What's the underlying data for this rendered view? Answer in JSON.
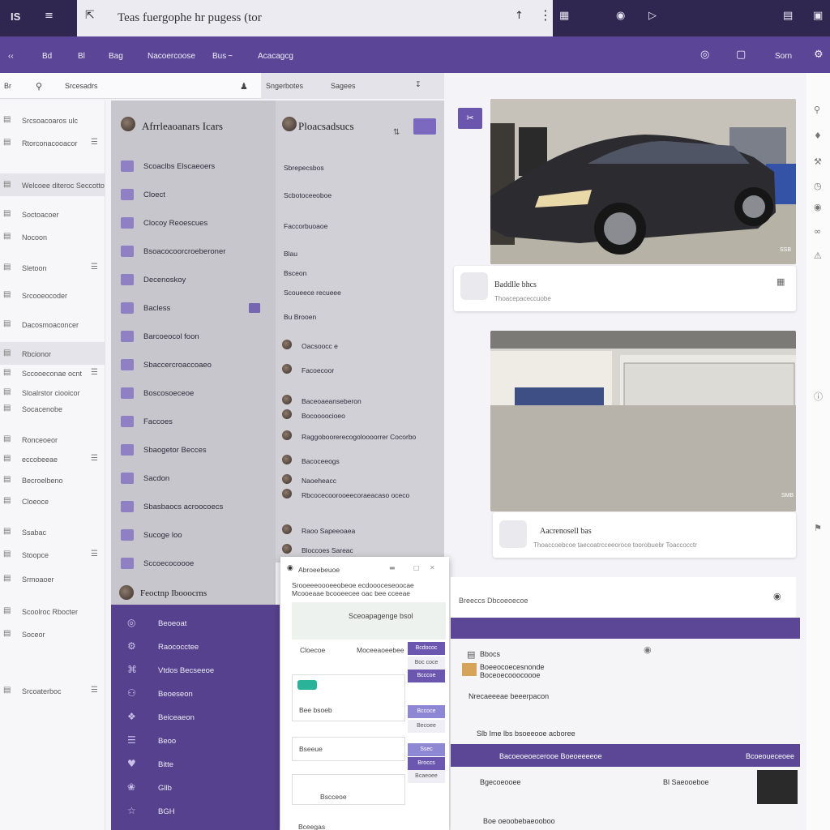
{
  "topbar": {
    "logo": "IS",
    "menu_icon": "menu-icon",
    "pin_icon": "pin-icon",
    "search_text": "Teas fuergophe hr pugess (tor",
    "right_icons": [
      "grid-icon",
      "shield-icon",
      "play-icon",
      "screen-icon",
      "picture-icon"
    ]
  },
  "toolbar": {
    "items": [
      "‹‹",
      "Bd",
      "Bl",
      "Bag",
      "Nacoercoose",
      "Bus ~",
      "Acacagcg"
    ],
    "right_label": "Sorn",
    "colors": {
      "bar": "#5a4597",
      "title": "#2f2750"
    }
  },
  "subbar": {
    "left_label": "Br",
    "search_label": "Srcesadrs",
    "right_a": "Sngerbotes",
    "right_b": "Sagees"
  },
  "leftlist": [
    "Srcsoacoaros ulc",
    "Rtorconacooacor",
    "Welcoee diteroc Seccotto",
    "Soctoacoer",
    "Nocoon",
    "Sletoon",
    "Srcooeocoder",
    "Dacosmoaconcer",
    "Rbcionor",
    "Sccooeconae ocnt",
    "Sloalrstor ciooicor",
    "Socacenobe",
    "Ronceoeor",
    "eccobeeae",
    "Becroelbeno",
    "Cloeoce",
    "Ssabac",
    "Stoopce",
    "Srmoaoer",
    "Scoolroc Rbocter",
    "Soceor",
    "Srcoaterboc"
  ],
  "col1": {
    "header": "Afrrleaoanars Icars",
    "items": [
      "Scoaclbs Elscaeoers",
      "Cloect",
      "Clocoy Reoescues",
      "Bsoacocoorcroeberoner",
      "Decenoskoy",
      "Bacless",
      "Barcoeocol foon",
      "Sbaccercroaccoaeo",
      "Boscosoeceoe",
      "Faccoes",
      "Sbaogetor Becces",
      "Sacdon",
      "Sbasbaocs acroocoecs",
      "Sucoge loo",
      "Sccoecocoooe"
    ],
    "footer": "Feoctnp Ibooocrns"
  },
  "col2": {
    "header": "Ploacsadsucs",
    "items": [
      "Sbrepecsbos",
      "Scbotoceeoboe",
      "Faccorbuoaoe",
      "Blau",
      "Bsceon",
      "Scoueece recueee",
      "Bu Brooen",
      "Oacsoocc e",
      "Facoecoor",
      "Baceoaeanseberon",
      "Bocoooocioeo",
      "Raggoboorerecogoloooorrer Cocorbo",
      "Bacoceeogs",
      "Naoeheacc",
      "Rbcocecoorooeecoraeacaso oceco",
      "Raoo Sapeeoaea",
      "Bloccoes Sareac"
    ]
  },
  "cards": [
    {
      "title": "Baddlle bhcs",
      "sub": "Thoacepaceccuobe",
      "tag": "SSB"
    },
    {
      "title": "Aacrenosell bas",
      "sub": "Thoaccoebcoe taecoatrcceeoroce toorobuebr Toaccocctr",
      "tag": "SMB"
    }
  ],
  "purplenav": [
    "Beoeoat",
    "Raococctee",
    "Vtdos Becseeoe",
    "Beoeseon",
    "Beiceaeon",
    "Beoo",
    "Bitte",
    "Gllb",
    "BGH"
  ],
  "popup": {
    "title": "Abroeebeuoe",
    "desc1": "Srooeeeoooeeobeoe ecdoooceseoocae",
    "desc2": "Mcooeaae bcooeecee oac bee cceeae",
    "search": "Sceoapagenge bsol",
    "label1": "Cloecoe",
    "label2": "Moceeaoeebee",
    "field1": "Bee bsoeb",
    "field2": "Bseeue",
    "field3": "Bscceoe",
    "footer": "Bceegas",
    "buttons": [
      "Bcdococ",
      "Bcccoe",
      "Bccoce",
      "Ssec",
      "Broccs"
    ],
    "options": [
      "Boc coce",
      "Becoee",
      "Bcaeoee"
    ]
  },
  "bottom": {
    "bar_title": "Breeccs Dbcoeoecoe",
    "win_title": "Bbocs",
    "line1": "Boeeocoecesnonde",
    "line2": "Boceoecooocoooe",
    "line3": "Nrecaeeeae beeerpacon",
    "line4": "Slb Ime lbs bsoeeooe acboree",
    "purple_row": "Bacoeoeoecerooe Boeoeeeeoe",
    "purple_right": "Bcoeoueceoee",
    "row2": "Bgecoeooee",
    "row2_right": "Bl Saeooeboe",
    "row3": "Boe oeoobebaeooboo"
  }
}
